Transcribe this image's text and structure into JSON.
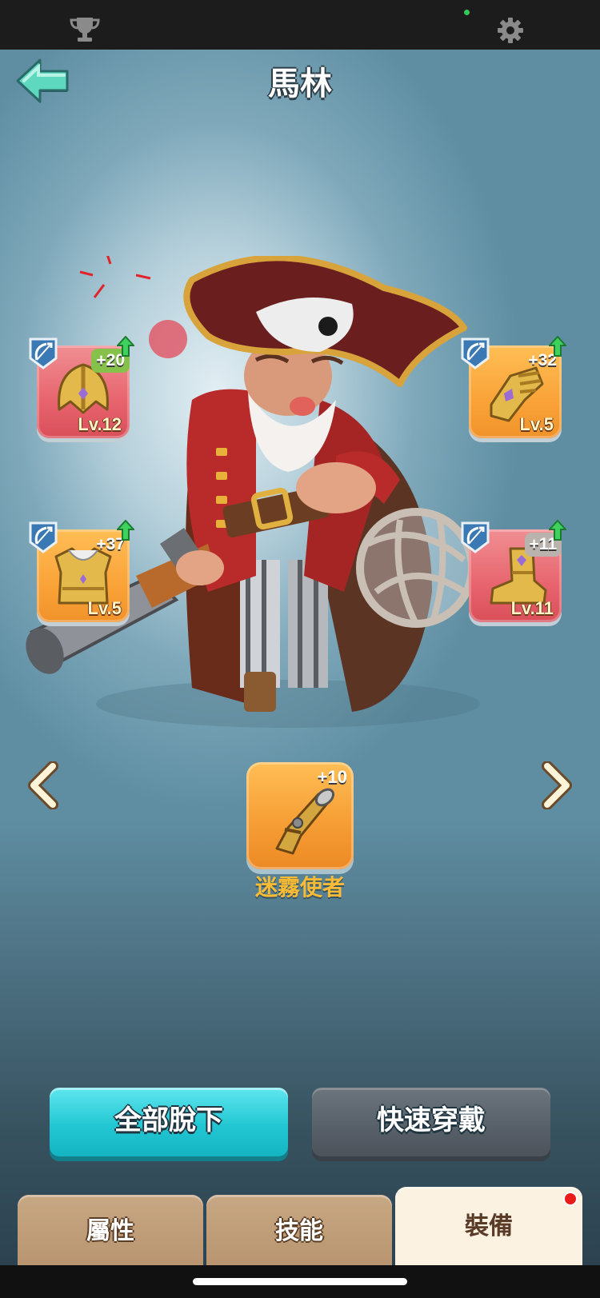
{
  "header": {
    "title": "馬林"
  },
  "equipment_slots": [
    {
      "bonus": "+20",
      "level": "Lv.12",
      "icon": "golden-helmet-icon",
      "frame": "red"
    },
    {
      "bonus": "+32",
      "level": "Lv.5",
      "icon": "golden-gauntlet-icon",
      "frame": "orange"
    },
    {
      "bonus": "+37",
      "level": "Lv.5",
      "icon": "golden-armor-icon",
      "frame": "orange"
    },
    {
      "bonus": "+11",
      "level": "Lv.11",
      "icon": "golden-boots-icon",
      "frame": "red"
    }
  ],
  "weapon": {
    "bonus": "+10",
    "name": "迷霧使者",
    "icon": "flintlock-pistol-icon"
  },
  "actions": {
    "unequip_all": "全部脫下",
    "quick_equip": "快速穿戴"
  },
  "tabs": [
    {
      "label": "屬性"
    },
    {
      "label": "技能"
    },
    {
      "label": "裝備"
    }
  ],
  "colors": {
    "accent_cyan": "#22c7d3",
    "weapon_name": "#f7bb36",
    "notification": "#ea1b1b",
    "status_dot": "#34c759"
  }
}
